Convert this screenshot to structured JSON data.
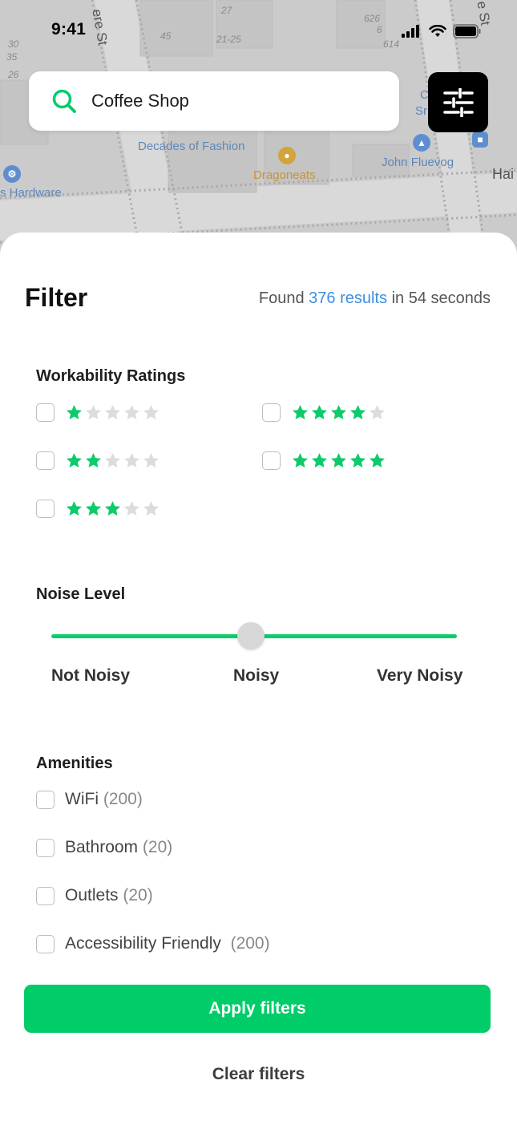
{
  "status_bar": {
    "time": "9:41"
  },
  "map": {
    "labels": {
      "decades": "Decades of Fashion",
      "dragoneats": "Dragoneats",
      "fluevog": "John Fluevog",
      "hardware": "s Hardware",
      "street_left": "ere St",
      "street_right": "e St",
      "hai": "Hai",
      "num_27": "27",
      "num_45": "45",
      "num_21_25": "21-25",
      "num_30": "30",
      "num_35": "35",
      "num_26": "26",
      "num_626": "626",
      "num_614": "614",
      "num_6": "6",
      "c_s": "C",
      "s_r": "Sr"
    }
  },
  "search": {
    "value": "Coffee Shop"
  },
  "filter": {
    "title": "Filter",
    "results_prefix": "Found ",
    "results_count": "376 results",
    "results_suffix": " in 54 seconds",
    "workability": {
      "title": "Workability Ratings",
      "options": [
        {
          "stars": 1,
          "checked": false
        },
        {
          "stars": 2,
          "checked": false
        },
        {
          "stars": 3,
          "checked": false
        },
        {
          "stars": 4,
          "checked": false
        },
        {
          "stars": 5,
          "checked": false
        }
      ],
      "max_stars": 5
    },
    "noise": {
      "title": "Noise Level",
      "labels": [
        "Not Noisy",
        "Noisy",
        "Very Noisy"
      ],
      "value": "Noisy"
    },
    "amenities": {
      "title": "Amenities",
      "items": [
        {
          "label": "WiFi",
          "count": "(200)"
        },
        {
          "label": "Bathroom",
          "count": "(20)"
        },
        {
          "label": "Outlets",
          "count": "(20)"
        },
        {
          "label": "Accessibility Friendly ",
          "count": "(200)"
        }
      ]
    },
    "apply_label": "Apply filters",
    "clear_label": "Clear filters"
  },
  "colors": {
    "accent_green": "#00cc6a",
    "star_filled": "#0ccc6a",
    "star_empty": "#dcdcdc",
    "link_blue": "#3d8fe0"
  },
  "icons": {
    "search": "search-icon",
    "filter": "sliders-icon"
  }
}
